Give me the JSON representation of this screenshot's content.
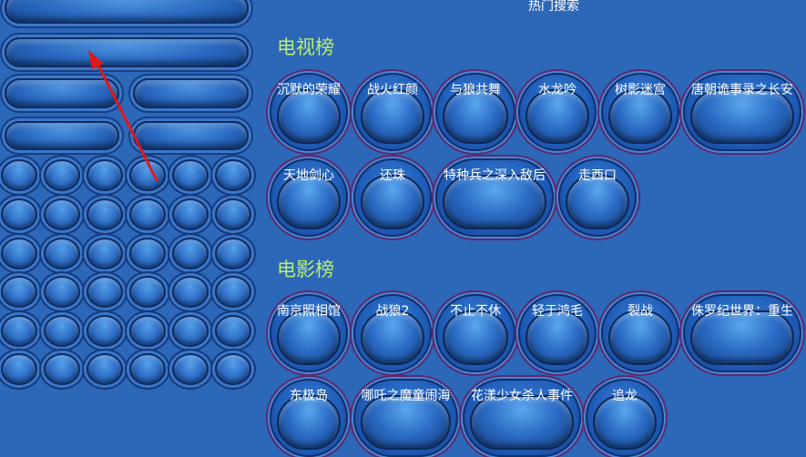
{
  "hot_search_title": "热门搜索",
  "tv": {
    "title": "电视榜",
    "items": [
      "沉默的荣耀",
      "战火红颜",
      "与狼共舞",
      "水龙吟",
      "树影迷宫",
      "唐朝诡事录之长安",
      "天地剑心",
      "还珠",
      "特种兵之深入敌后",
      "走西口"
    ]
  },
  "movie": {
    "title": "电影榜",
    "items": [
      "南京照相馆",
      "战狼2",
      "不止不休",
      "轻于鸿毛",
      "裂战",
      "侏罗纪世界：重生",
      "东极岛",
      "哪吒之魔童闹海",
      "花漾少女杀人事件",
      "追龙"
    ]
  },
  "colors": {
    "background": "#2d67b8",
    "section_title": "#b7f06a",
    "arrow": "#e01818"
  }
}
